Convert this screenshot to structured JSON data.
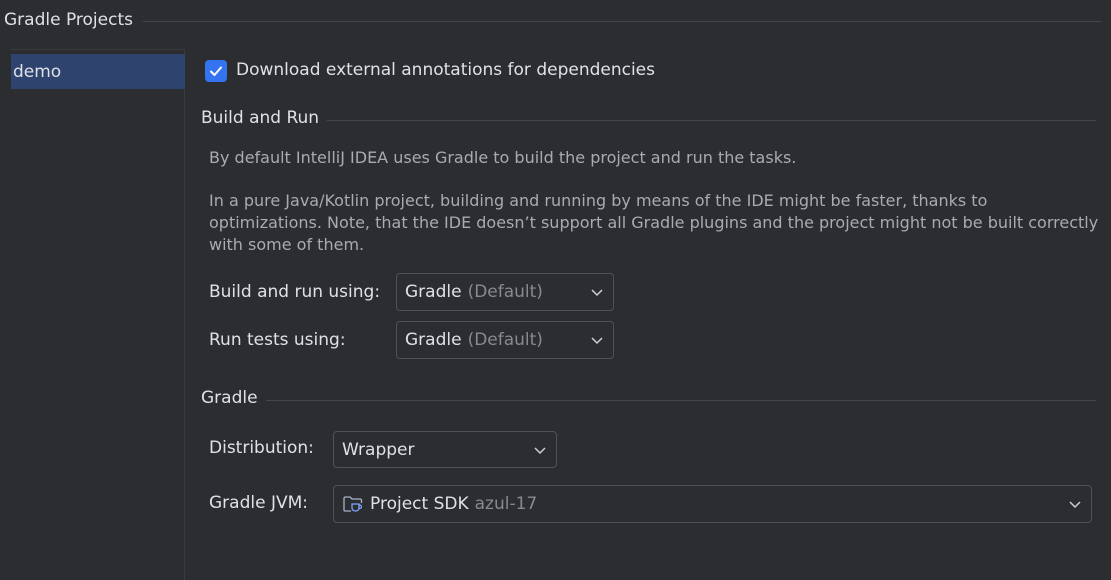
{
  "header": {
    "title": "Gradle Projects"
  },
  "projects": {
    "items": [
      {
        "label": "demo",
        "selected": true
      }
    ]
  },
  "download_annotations": {
    "checked": true,
    "label": "Download external annotations for dependencies"
  },
  "build_and_run": {
    "title": "Build and Run",
    "desc1": "By default IntelliJ IDEA uses Gradle to build the project and run the tasks.",
    "desc2_line1": "In a pure Java/Kotlin project, building and running by means of the IDE might be faster, thanks to",
    "desc2_line2": "optimizations. Note, that the IDE doesn’t support all Gradle plugins and the project might not be built correctly",
    "desc2_line3": "with some of them.",
    "build_using": {
      "label": "Build and run using:",
      "value": "Gradle",
      "hint": "(Default)"
    },
    "test_using": {
      "label": "Run tests using:",
      "value": "Gradle",
      "hint": "(Default)"
    }
  },
  "gradle": {
    "title": "Gradle",
    "distribution": {
      "label": "Distribution:",
      "value": "Wrapper"
    },
    "jvm": {
      "label": "Gradle JVM:",
      "value": "Project SDK",
      "hint": "azul-17",
      "icon": "folder-sdk-icon"
    }
  },
  "colors": {
    "accent": "#3574f0",
    "selection": "#2e436e",
    "background": "#2b2d30"
  }
}
